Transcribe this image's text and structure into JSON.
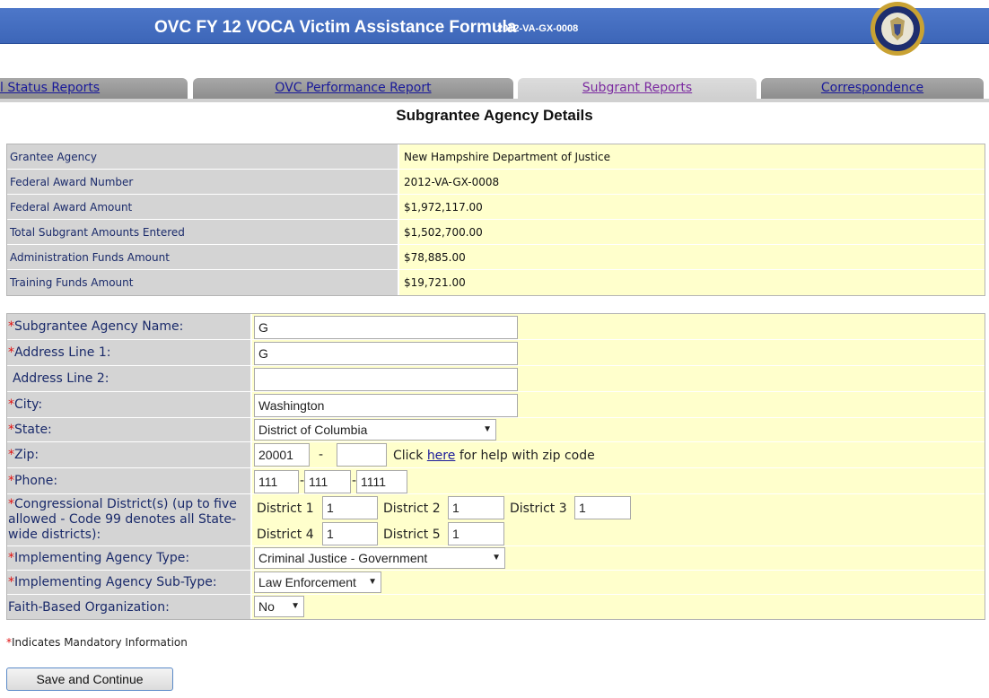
{
  "header": {
    "title": "OVC FY 12 VOCA Victim Assistance Formula",
    "award_code": "2012-VA-GX-0008",
    "seal_icon": "doj-seal-icon"
  },
  "tabs": [
    {
      "label": "l Status Reports",
      "active": false
    },
    {
      "label": "OVC Performance Report",
      "active": false
    },
    {
      "label": "Subgrant Reports",
      "active": true
    },
    {
      "label": "Correspondence",
      "active": false
    }
  ],
  "page_title": "Subgrantee Agency Details",
  "summary": [
    {
      "label": "Grantee Agency",
      "value": "New Hampshire Department of Justice"
    },
    {
      "label": "Federal Award Number",
      "value": "2012-VA-GX-0008"
    },
    {
      "label": "Federal Award Amount",
      "value": "$1,972,117.00"
    },
    {
      "label": "Total Subgrant Amounts Entered",
      "value": "$1,502,700.00"
    },
    {
      "label": "Administration Funds Amount",
      "value": "$78,885.00"
    },
    {
      "label": "Training Funds Amount",
      "value": "$19,721.00"
    }
  ],
  "form": {
    "agency_name": {
      "label": "Subgrantee Agency Name:",
      "value": "G"
    },
    "address1": {
      "label": "Address Line 1:",
      "value": "G"
    },
    "address2": {
      "label": "Address Line 2:",
      "value": ""
    },
    "city": {
      "label": "City:",
      "value": "Washington"
    },
    "state": {
      "label": "State:",
      "value": "District of Columbia"
    },
    "zip": {
      "label": "Zip:",
      "zip5": "20001",
      "dash": "-",
      "zip4": "",
      "help_pre": "Click ",
      "help_link": "here",
      "help_post": " for help with zip code"
    },
    "phone": {
      "label": "Phone:",
      "area": "111",
      "prefix": "111",
      "line": "1111",
      "dash": "-"
    },
    "districts": {
      "label": "Congressional District(s) (up to five allowed - Code 99 denotes all State-wide districts):",
      "items": [
        {
          "label": "District 1",
          "value": "1"
        },
        {
          "label": "District 2",
          "value": "1"
        },
        {
          "label": "District 3",
          "value": "1"
        },
        {
          "label": "District 4",
          "value": "1"
        },
        {
          "label": "District 5",
          "value": "1"
        }
      ]
    },
    "agency_type": {
      "label": "Implementing Agency Type:",
      "value": "Criminal Justice - Government"
    },
    "agency_subtype": {
      "label": "Implementing Agency Sub-Type:",
      "value": "Law Enforcement"
    },
    "faith_based": {
      "label": "Faith-Based Organization:",
      "value": "No"
    },
    "required_mark": "*"
  },
  "mandatory_note": "Indicates Mandatory Information",
  "save_button": "Save and Continue",
  "colors": {
    "banner": "#3d66b8",
    "label_bg": "#d4d4d4",
    "value_bg": "#ffffcc",
    "required": "#e01010"
  }
}
